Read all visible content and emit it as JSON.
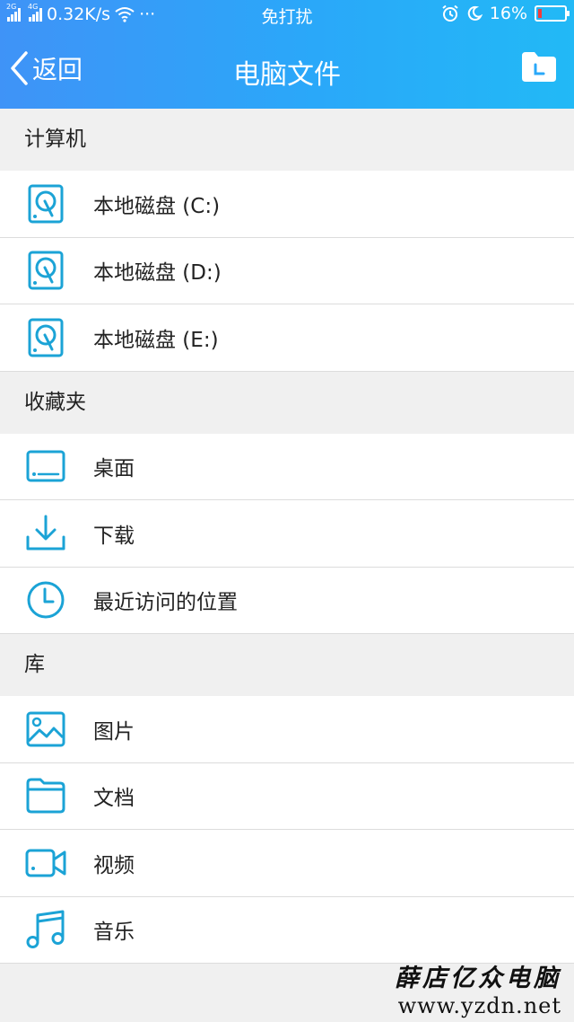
{
  "status_bar": {
    "network_tag_1": "2G",
    "network_tag_2": "4G",
    "speed": "0.32K/s",
    "more": "···",
    "mode": "免打扰",
    "battery_percent": "16%",
    "battery_level": 0.16
  },
  "nav": {
    "back_label": "返回",
    "title": "电脑文件"
  },
  "sections": {
    "computer": {
      "header": "计算机",
      "items": [
        "本地磁盘 (C:)",
        "本地磁盘 (D:)",
        "本地磁盘 (E:)"
      ]
    },
    "favorites": {
      "header": "收藏夹",
      "items": [
        "桌面",
        "下载",
        "最近访问的位置"
      ]
    },
    "library": {
      "header": "库",
      "items": [
        "图片",
        "文档",
        "视频",
        "音乐"
      ]
    }
  },
  "watermark": {
    "name": "薛店亿众电脑",
    "url": "www.yzdn.net"
  },
  "colors": {
    "accent": "#2aa8f9",
    "icon": "#1ba3d6",
    "battery_low": "#f23b3b"
  }
}
